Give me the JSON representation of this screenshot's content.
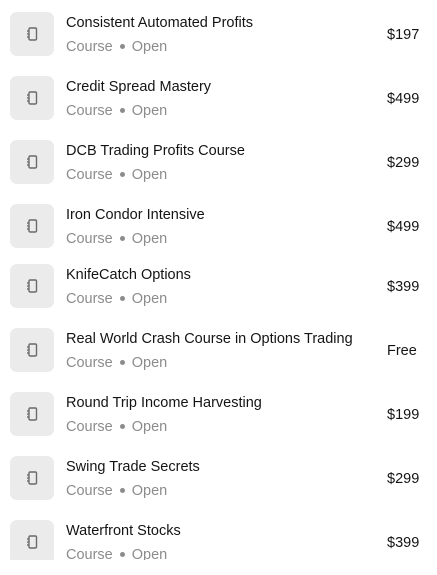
{
  "products": [
    {
      "title": "Consistent Automated Profits",
      "type": "Course",
      "status": "Open",
      "price": "$197",
      "icon": "book-icon"
    },
    {
      "title": "Credit Spread Mastery",
      "type": "Course",
      "status": "Open",
      "price": "$499",
      "icon": "book-icon"
    },
    {
      "title": "DCB Trading Profits Course",
      "type": "Course",
      "status": "Open",
      "price": "$299",
      "icon": "book-icon"
    },
    {
      "title": "Iron Condor Intensive",
      "type": "Course",
      "status": "Open",
      "price": "$499",
      "icon": "book-icon"
    },
    {
      "title": "KnifeCatch Options",
      "type": "Course",
      "status": "Open",
      "price": "$399",
      "icon": "book-icon"
    },
    {
      "title": "Real World Crash Course in Options Trading",
      "type": "Course",
      "status": "Open",
      "price": "Free",
      "icon": "book-icon"
    },
    {
      "title": "Round Trip Income Harvesting",
      "type": "Course",
      "status": "Open",
      "price": "$199",
      "icon": "book-icon"
    },
    {
      "title": "Swing Trade Secrets",
      "type": "Course",
      "status": "Open",
      "price": "$299",
      "icon": "book-icon"
    },
    {
      "title": "Waterfront Stocks",
      "type": "Course",
      "status": "Open",
      "price": "$399",
      "icon": "book-icon"
    }
  ],
  "colors": {
    "thumb_background": "#ebebeb",
    "icon": "#6b6b6b",
    "title_text": "#141414",
    "meta_text": "#8c8c8c"
  }
}
